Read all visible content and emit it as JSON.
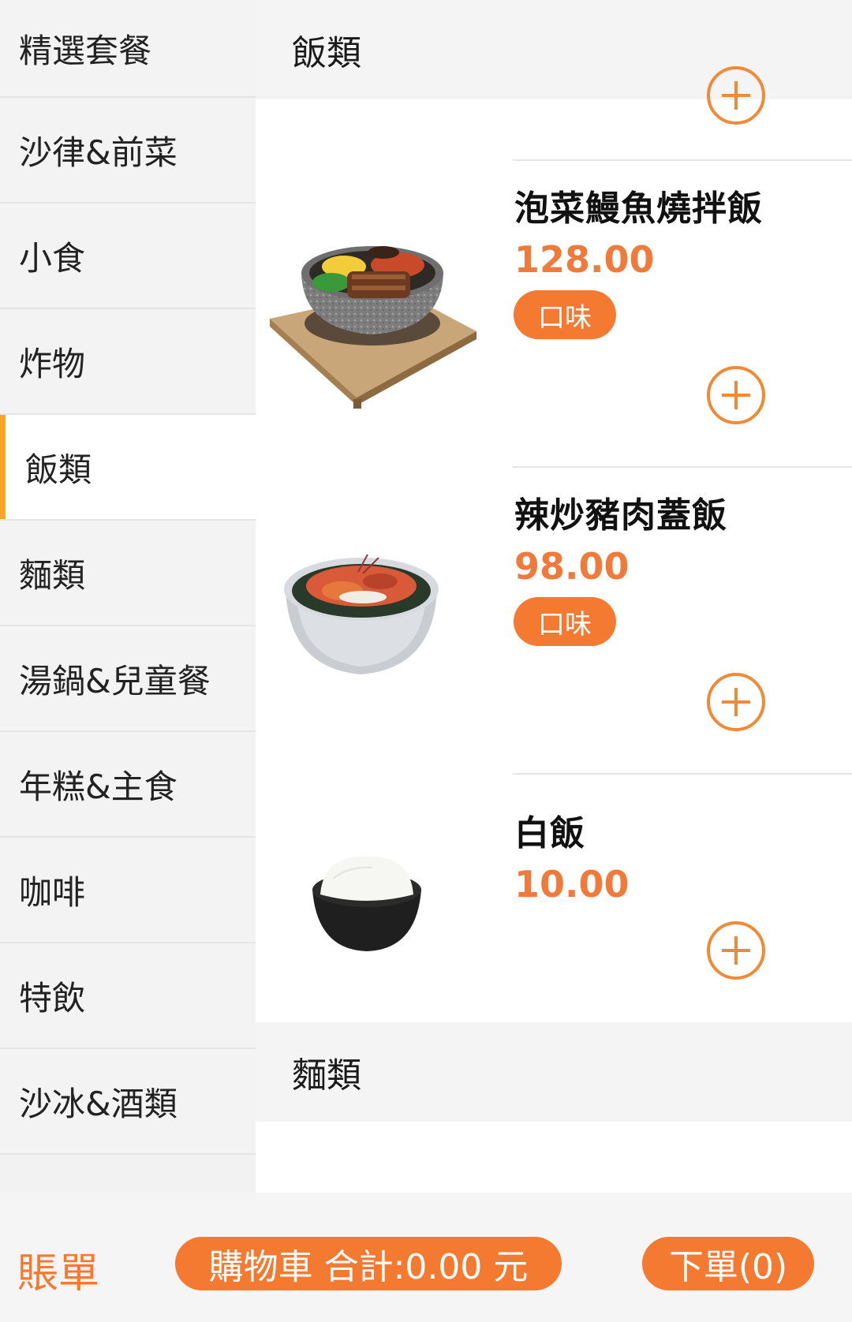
{
  "sidebar": {
    "categories": [
      {
        "label": "精選套餐"
      },
      {
        "label": "沙律&前菜"
      },
      {
        "label": "小食"
      },
      {
        "label": "炸物"
      },
      {
        "label": "飯類"
      },
      {
        "label": "麵類"
      },
      {
        "label": "湯鍋&兒童餐"
      },
      {
        "label": "年糕&主食"
      },
      {
        "label": "咖啡"
      },
      {
        "label": "特飲"
      },
      {
        "label": "沙冰&酒類"
      }
    ],
    "active_index": 4
  },
  "content": {
    "section_title": "飯類",
    "next_section_title": "麵類",
    "items": [
      {
        "name": "泡菜鰻魚燒拌飯",
        "price": "128.00",
        "flavor_label": "口味",
        "image": "stone-bowl-bibimbap-image"
      },
      {
        "name": "辣炒豬肉蓋飯",
        "price": "98.00",
        "flavor_label": "口味",
        "image": "spicy-pork-rice-bowl-image"
      },
      {
        "name": "白飯",
        "price": "10.00",
        "image": "white-rice-bowl-image"
      }
    ]
  },
  "bottom_bar": {
    "bill_label": "賬單",
    "cart_label": "購物車 合計:0.00 元",
    "order_label": "下單(0)"
  },
  "colors": {
    "accent": "#f47a31",
    "active_indicator": "#f6a623",
    "price": "#f07a3a"
  },
  "icons": [
    "add-circle-icon"
  ]
}
